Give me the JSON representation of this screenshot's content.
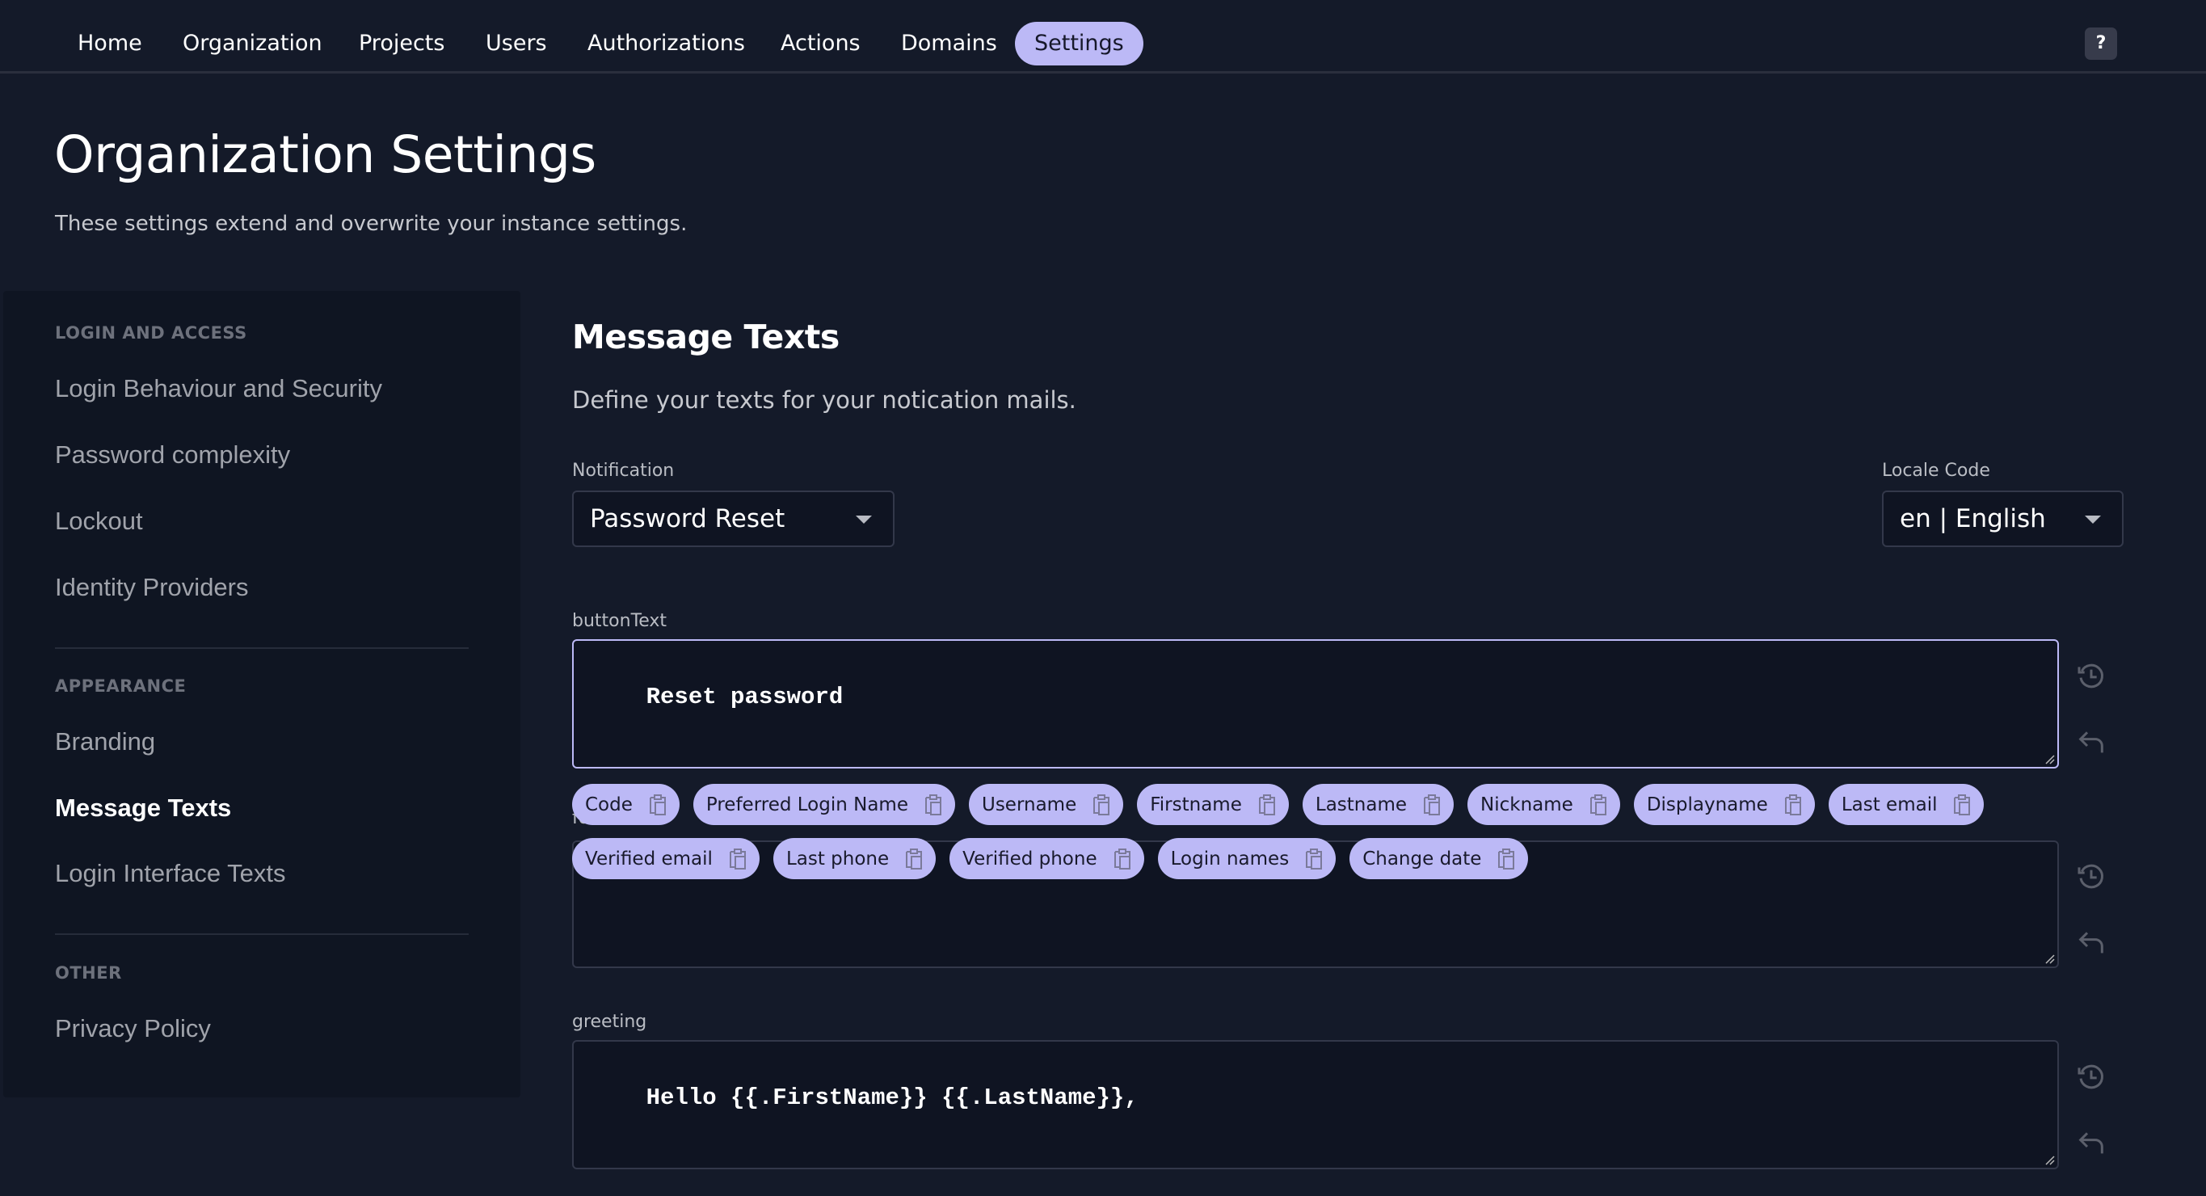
{
  "topnav": {
    "items": [
      {
        "label": "Home",
        "active": false
      },
      {
        "label": "Organization",
        "active": false
      },
      {
        "label": "Projects",
        "active": false
      },
      {
        "label": "Users",
        "active": false
      },
      {
        "label": "Authorizations",
        "active": false
      },
      {
        "label": "Actions",
        "active": false
      },
      {
        "label": "Domains",
        "active": false
      },
      {
        "label": "Settings",
        "active": true
      }
    ],
    "help_label": "?"
  },
  "page": {
    "title": "Organization Settings",
    "subtitle": "These settings extend and overwrite your instance settings."
  },
  "sidebar": {
    "sections": [
      {
        "title": "LOGIN AND ACCESS",
        "items": [
          {
            "label": "Login Behaviour and Security",
            "active": false
          },
          {
            "label": "Password complexity",
            "active": false
          },
          {
            "label": "Lockout",
            "active": false
          },
          {
            "label": "Identity Providers",
            "active": false
          }
        ]
      },
      {
        "title": "APPEARANCE",
        "items": [
          {
            "label": "Branding",
            "active": false
          },
          {
            "label": "Message Texts",
            "active": true
          },
          {
            "label": "Login Interface Texts",
            "active": false
          }
        ]
      },
      {
        "title": "OTHER",
        "items": [
          {
            "label": "Privacy Policy",
            "active": false
          }
        ]
      }
    ]
  },
  "main": {
    "title": "Message Texts",
    "description": "Define your texts for your notication mails.",
    "notification": {
      "label": "Notification",
      "value": "Password Reset"
    },
    "locale": {
      "label": "Locale Code",
      "value": "en | English"
    },
    "fields": [
      {
        "label": "buttonText",
        "value": "Reset password",
        "focused": true
      },
      {
        "label": "footerText",
        "value": "",
        "focused": false
      },
      {
        "label": "greeting",
        "value": "Hello {{.FirstName}} {{.LastName}},",
        "focused": false
      }
    ],
    "chips_row1": [
      "Code",
      "Preferred Login Name",
      "Username",
      "Firstname",
      "Lastname",
      "Nickname",
      "Displayname",
      "Last email"
    ],
    "chips_row2": [
      "Verified email",
      "Last phone",
      "Verified phone",
      "Login names",
      "Change date"
    ]
  },
  "icons": {
    "history": "history-icon",
    "undo": "undo-icon",
    "copy": "clipboard-icon",
    "caret": "chevron-down-icon"
  },
  "colors": {
    "accent": "#bcb9f6",
    "background": "#141a29",
    "panel": "#0f1522"
  }
}
